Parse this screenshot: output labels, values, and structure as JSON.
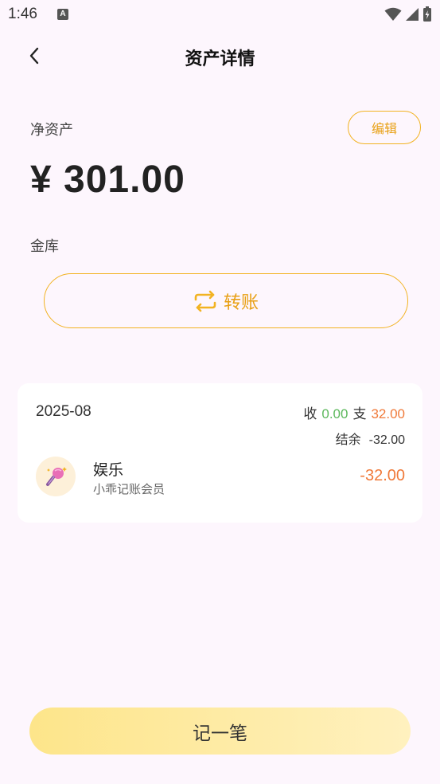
{
  "status_bar": {
    "time": "1:46",
    "notification_icon": "A"
  },
  "header": {
    "title": "资产详情"
  },
  "account": {
    "net_label": "净资产",
    "edit_label": "编辑",
    "net_amount": "¥ 301.00",
    "name": "金库",
    "transfer_label": "转账"
  },
  "records": {
    "month": "2025-08",
    "income_label": "收",
    "income_value": "0.00",
    "expense_label": "支",
    "expense_value": "32.00",
    "balance_label": "结余",
    "balance_value": "-32.00",
    "entries": [
      {
        "category": "娱乐",
        "note": "小乖记账会员",
        "amount": "-32.00",
        "icon": "microphone-icon"
      }
    ]
  },
  "footer": {
    "record_label": "记一笔"
  },
  "colors": {
    "accent": "#f2b322",
    "income": "#5cb85c",
    "expense": "#f07a3a",
    "background": "#fdf6fd"
  }
}
